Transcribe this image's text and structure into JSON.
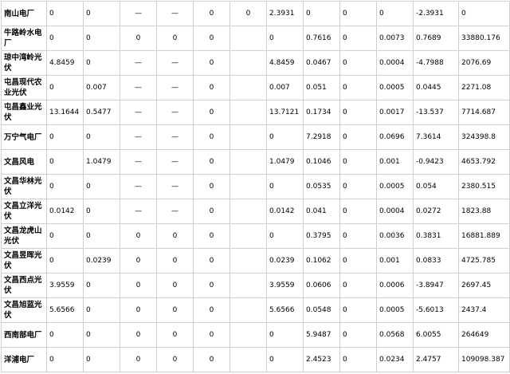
{
  "table": {
    "rows": [
      {
        "name": "南山电厂",
        "cells": [
          "0",
          "0",
          "—",
          "—",
          "0",
          "0",
          "2.3931",
          "0",
          "0",
          "0",
          "-2.3931",
          "0"
        ]
      },
      {
        "name": "牛路岭水电厂",
        "cells": [
          "0",
          "0",
          "0",
          "0",
          "0",
          "0",
          "0.7616",
          "0",
          "0.0073",
          "0.7689",
          "33880.176"
        ]
      },
      {
        "name": "琼中湾岭光伏",
        "cells": [
          "4.8459",
          "0",
          "—",
          "—",
          "0",
          "4.8459",
          "0.0467",
          "0",
          "0.0004",
          "-4.7988",
          "2076.69"
        ]
      },
      {
        "name": "屯昌现代农业光伏",
        "cells": [
          "0",
          "0.007",
          "—",
          "—",
          "0",
          "0.007",
          "0.051",
          "0",
          "0.0005",
          "0.0445",
          "2271.08"
        ]
      },
      {
        "name": "屯昌鑫业光伏",
        "cells": [
          "13.1644",
          "0.5477",
          "—",
          "—",
          "0",
          "13.7121",
          "0.1734",
          "0",
          "0.0017",
          "-13.537",
          "7714.687"
        ]
      },
      {
        "name": "万宁气电厂",
        "cells": [
          "0",
          "0",
          "—",
          "—",
          "0",
          "0",
          "7.2918",
          "0",
          "0.0696",
          "7.3614",
          "324398.8"
        ]
      },
      {
        "name": "文昌风电",
        "cells": [
          "0",
          "1.0479",
          "—",
          "—",
          "0",
          "1.0479",
          "0.1046",
          "0",
          "0.001",
          "-0.9423",
          "4653.792"
        ]
      },
      {
        "name": "文昌华林光伏",
        "cells": [
          "0",
          "0",
          "—",
          "—",
          "0",
          "0",
          "0.0535",
          "0",
          "0.0005",
          "0.054",
          "2380.515"
        ]
      },
      {
        "name": "文昌立洋光伏",
        "cells": [
          "0.0142",
          "0",
          "—",
          "—",
          "0",
          "0.0142",
          "0.041",
          "0",
          "0.0004",
          "0.0272",
          "1823.88"
        ]
      },
      {
        "name": "文昌龙虎山光伏",
        "cells": [
          "0",
          "0",
          "0",
          "0",
          "0",
          "0",
          "0.3795",
          "0",
          "0.0036",
          "0.3831",
          "16881.889"
        ]
      },
      {
        "name": "文昌昱晖光伏",
        "cells": [
          "0",
          "0.0239",
          "0",
          "0",
          "0",
          "0.0239",
          "0.1062",
          "0",
          "0.001",
          "0.0833",
          "4725.785"
        ]
      },
      {
        "name": "文昌西点光伏",
        "cells": [
          "3.9559",
          "0",
          "0",
          "0",
          "0",
          "3.9559",
          "0.0606",
          "0",
          "0.0006",
          "-3.8947",
          "2697.45"
        ]
      },
      {
        "name": "文昌旭蓝光伏",
        "cells": [
          "5.6566",
          "0",
          "0",
          "0",
          "0",
          "5.6566",
          "0.0548",
          "0",
          "0.0005",
          "-5.6013",
          "2437.4"
        ]
      },
      {
        "name": "西南部电厂",
        "cells": [
          "0",
          "0",
          "0",
          "0",
          "0",
          "0",
          "5.9487",
          "0",
          "0.0568",
          "6.0055",
          "264649"
        ]
      },
      {
        "name": "洋浦电厂",
        "cells": [
          "0",
          "0",
          "0",
          "0",
          "0",
          "0",
          "2.4523",
          "0",
          "0.0234",
          "2.4757",
          "109098.387"
        ]
      }
    ]
  }
}
